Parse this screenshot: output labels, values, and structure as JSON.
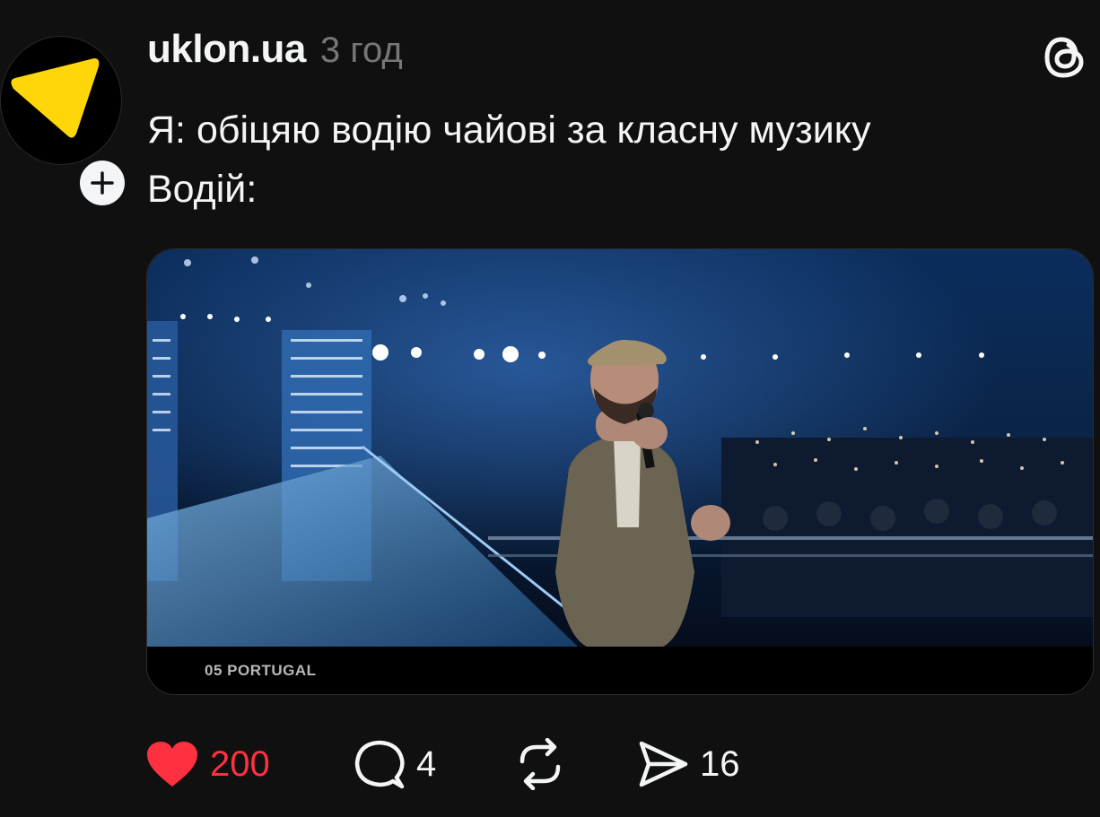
{
  "post": {
    "author": {
      "username": "uklon.ua",
      "time_ago": "3 год",
      "avatar_icon": "uklon-logo",
      "follow_icon": "plus-icon"
    },
    "caption": [
      "Я: обіцяю водію чайові за класну музику",
      "Водій:"
    ],
    "media": {
      "type": "video",
      "overlay_text": "05 PORTUGAL"
    },
    "actions": {
      "likes": "200",
      "liked": true,
      "comments": "4",
      "reposts": "",
      "shares": "16"
    }
  },
  "colors": {
    "background": "#101010",
    "text": "#f3f5f7",
    "muted": "#777777",
    "like": "#ff3040",
    "brand_yellow": "#ffd60a"
  }
}
